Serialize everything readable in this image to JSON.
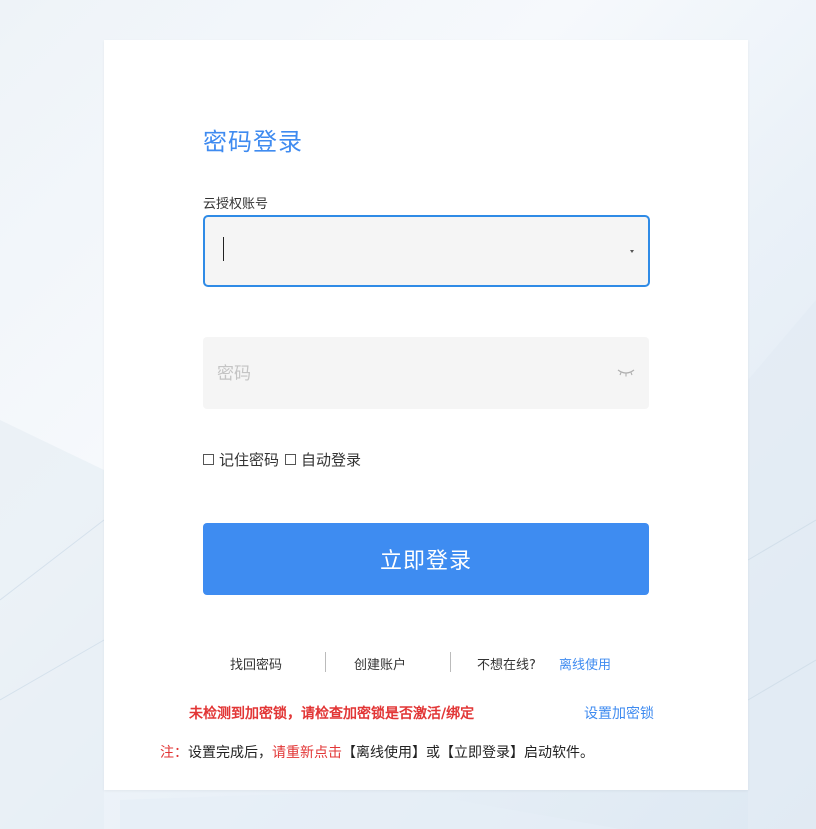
{
  "login": {
    "title": "密码登录",
    "account_label": "云授权账号",
    "password_placeholder": "密码",
    "remember_password": "记住密码",
    "auto_login": "自动登录",
    "login_button": "立即登录"
  },
  "links": {
    "recover_password": "找回密码",
    "create_account": "创建账户",
    "no_online": "不想在线?",
    "offline_use": "离线使用"
  },
  "warning": {
    "text": "未检测到加密锁，请检查加密锁是否激活/绑定",
    "set_lock": "设置加密锁"
  },
  "note": {
    "prefix": "注：",
    "part1": "设置完成后，",
    "part2": "请重新点击",
    "part3": "【离线使用】或【立即登录】启动软件。"
  },
  "colors": {
    "accent": "#3e8cf1",
    "warning": "#e23636",
    "input_bg": "#f5f5f5",
    "focus_border": "#2f8be6"
  },
  "icons": {
    "password_toggle": "eye-closed-icon",
    "dropdown": "caret-down-icon"
  }
}
